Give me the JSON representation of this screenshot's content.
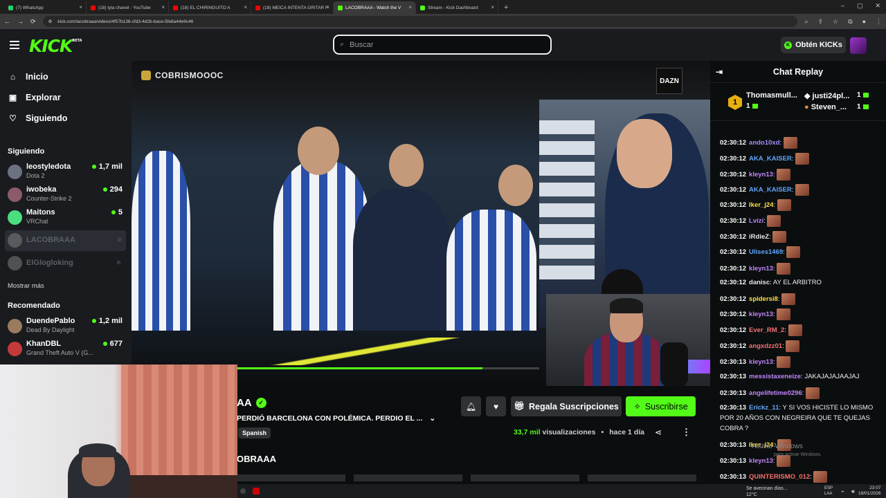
{
  "browser": {
    "tabs": [
      {
        "label": "(7) WhatsApp",
        "color": "#25d366"
      },
      {
        "label": "(18) tyla chanel - YouTube",
        "color": "#ff0000"
      },
      {
        "label": "(18) EL CHIRINGUITO A",
        "color": "#ff0000"
      },
      {
        "label": "(18) MEICA INTENTA GRITAR F",
        "color": "#ff0000"
      },
      {
        "label": "LACOBRAAA - Watch the V",
        "color": "#53fc18"
      },
      {
        "label": "Stream - Kick Dashboard",
        "color": "#53fc18"
      }
    ],
    "active_tab": 4,
    "url": "kick.com/lacobraaa/videos/4f57b136-cfd3-4d2b-bace-5fe8a44e9c46"
  },
  "header": {
    "logo": "KICK",
    "logo_beta": "BETA",
    "search_placeholder": "Buscar",
    "kicks_label": "Obtén KICKs"
  },
  "sidebar": {
    "nav": [
      {
        "label": "Inicio",
        "icon": "home-icon"
      },
      {
        "label": "Explorar",
        "icon": "explore-icon"
      },
      {
        "label": "Siguiendo",
        "icon": "heart-icon"
      }
    ],
    "following_title": "Siguiendo",
    "following": [
      {
        "name": "leostyledota",
        "game": "Dota 2",
        "viewers": "1,7 mil"
      },
      {
        "name": "iwobeka",
        "game": "Counter-Strike 2",
        "viewers": "294"
      },
      {
        "name": "Maitons",
        "game": "VRChat",
        "viewers": "5"
      },
      {
        "name": "LACOBRAAA",
        "game": "",
        "viewers": ""
      },
      {
        "name": "ElGlogloking",
        "game": "",
        "viewers": ""
      }
    ],
    "show_more": "Mostrar más",
    "recommended_title": "Recomendado",
    "recommended": [
      {
        "name": "DuendePablo",
        "game": "Dead By Daylight",
        "viewers": "1,2 mil"
      },
      {
        "name": "KhanDBL",
        "game": "Grand Theft Auto V (G...",
        "viewers": "677"
      }
    ]
  },
  "video": {
    "watermark": "COBRISMOOOC",
    "dazn": "DAZN",
    "progress_fraction": 0.861
  },
  "info": {
    "channel": "AA",
    "title": "PERDIÓ BARCELONA CON POLÉMICA. PERDIO EL ...",
    "language": "Spanish",
    "gift_label": "Regala Suscripciones",
    "subscribe_label": "Suscribirse",
    "views": "33,7 mil",
    "views_label": "visualizaciones",
    "age": "hace 1 día",
    "channel_section": "OBRAAA"
  },
  "chat": {
    "title": "Chat Replay",
    "gifters": [
      {
        "name": "Thomasmull...",
        "count": "1"
      },
      {
        "name": "justi24pl...",
        "count": "1"
      },
      {
        "name": "Steven_...",
        "count": "1"
      }
    ],
    "top_rank": "1",
    "messages": [
      {
        "ts": "02:30:12",
        "user": "ando10xd",
        "color": "#a78bfa",
        "text": "",
        "emote": true
      },
      {
        "ts": "02:30:12",
        "user": "AKA_KAISER",
        "color": "#60a5fa",
        "text": "",
        "emote": true
      },
      {
        "ts": "02:30:12",
        "user": "kleyn13",
        "color": "#c084fc",
        "text": "",
        "emote": true
      },
      {
        "ts": "02:30:12",
        "user": "AKA_KAISER",
        "color": "#60a5fa",
        "text": "",
        "emote": true
      },
      {
        "ts": "02:30:12",
        "user": "Iker_j24",
        "color": "#fde047",
        "text": "",
        "emote": true
      },
      {
        "ts": "02:30:12",
        "user": "Lvizi",
        "color": "#c084fc",
        "text": "",
        "emote": true
      },
      {
        "ts": "02:30:12",
        "user": "iRdieZ",
        "color": "#e5e7eb",
        "text": "",
        "emote": true
      },
      {
        "ts": "02:30:12",
        "user": "Ulises1469",
        "color": "#60a5fa",
        "text": "",
        "emote": true
      },
      {
        "ts": "02:30:12",
        "user": "kleyn13",
        "color": "#c084fc",
        "text": "",
        "emote": true
      },
      {
        "ts": "02:30:12",
        "user": "danisc",
        "color": "#e5e7eb",
        "text": "AY EL ARBITRO",
        "emote": false
      },
      {
        "ts": "02:30:12",
        "user": "spidersi8",
        "color": "#fde047",
        "text": "",
        "emote": true
      },
      {
        "ts": "02:30:12",
        "user": "kleyn13",
        "color": "#c084fc",
        "text": "",
        "emote": true
      },
      {
        "ts": "02:30:12",
        "user": "Ever_RM_2",
        "color": "#f87171",
        "text": "",
        "emote": true
      },
      {
        "ts": "02:30:12",
        "user": "angxdzz01",
        "color": "#f87171",
        "text": "",
        "emote": true
      },
      {
        "ts": "02:30:13",
        "user": "kleyn13",
        "color": "#c084fc",
        "text": "",
        "emote": true
      },
      {
        "ts": "02:30:13",
        "user": "messistaxeneize",
        "color": "#c084fc",
        "text": "JAKAJAJAJAAJAJ",
        "emote": false
      },
      {
        "ts": "02:30:13",
        "user": "angelifetime0296",
        "color": "#c084fc",
        "text": "",
        "emote": true
      },
      {
        "ts": "02:30:13",
        "user": "Erickz_11",
        "color": "#60a5fa",
        "text": "Y SI VOS HICISTE LO MISMO POR 20 AÑOS CON NEGREIRA QUE TE QUEJAS COBRA ?",
        "emote": false
      },
      {
        "ts": "02:30:13",
        "user": "Iker_j24",
        "color": "#fde047",
        "text": "",
        "emote": true
      },
      {
        "ts": "02:30:13",
        "user": "kleyn13",
        "color": "#c084fc",
        "text": "",
        "emote": true
      },
      {
        "ts": "02:30:13",
        "user": "QUINTERISMO_012",
        "color": "#f87171",
        "text": "",
        "emote": true
      }
    ],
    "activate_windows": "Activar Windows",
    "activate_windows_sub": "para activar Windows."
  },
  "taskbar": {
    "weather": "Se avecinan días...",
    "temp": "12°C",
    "lang1": "ESP",
    "lang2": "LAA",
    "time": "23:07",
    "date": "19/01/2026"
  }
}
